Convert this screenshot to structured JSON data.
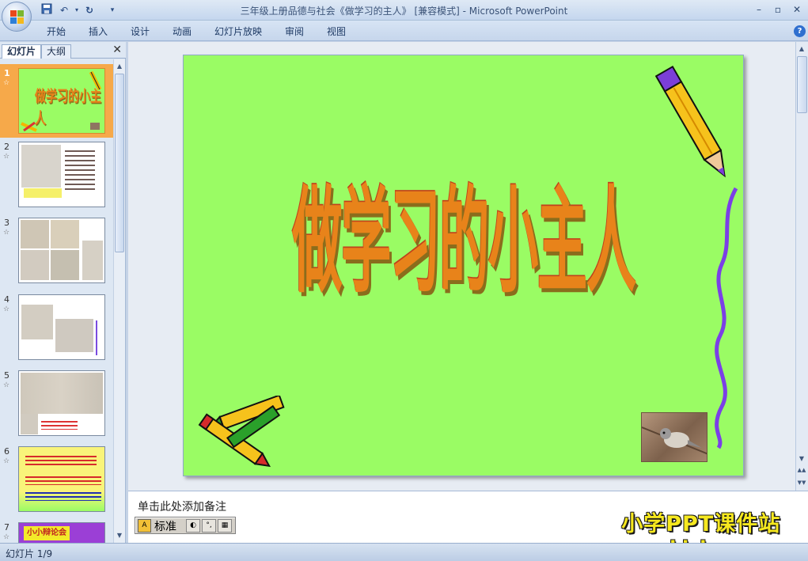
{
  "window": {
    "title": "三年级上册品德与社会《做学习的主人》 [兼容模式] - Microsoft PowerPoint",
    "controls": [
      "–",
      "▫",
      "✕"
    ]
  },
  "ribbon": {
    "tabs": [
      "开始",
      "插入",
      "设计",
      "动画",
      "幻灯片放映",
      "审阅",
      "视图"
    ]
  },
  "left_panel": {
    "tabs": {
      "slides": "幻灯片",
      "outline": "大纲"
    },
    "close": "✕",
    "thumbnails": [
      {
        "number": "1",
        "title": "做学习的小主人"
      },
      {
        "number": "2"
      },
      {
        "number": "3"
      },
      {
        "number": "4"
      },
      {
        "number": "5"
      },
      {
        "number": "6"
      },
      {
        "number": "7",
        "title": "小小辩论会"
      }
    ]
  },
  "slide": {
    "title": "做学习的小主人",
    "background": "#9afc64"
  },
  "notes": {
    "placeholder": "单击此处添加备注"
  },
  "ime": {
    "mode": "标准"
  },
  "watermark": {
    "line1": "小学PPT课件站",
    "line2": "www.kjzhan.com"
  },
  "status": {
    "slide_counter": "幻灯片 1/9"
  },
  "colors": {
    "accent": "#f6a94a",
    "slide_green": "#9afc64",
    "title_orange": "#e8831a"
  }
}
